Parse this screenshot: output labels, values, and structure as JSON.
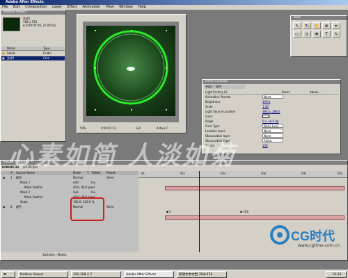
{
  "app": {
    "title": "Adobe After Effects"
  },
  "menu": [
    "File",
    "Edit",
    "Composition",
    "Layer",
    "Effect",
    "Animation",
    "View",
    "Window",
    "Help"
  ],
  "project": {
    "title": "Untitled Project",
    "comp_name": "合成1",
    "info1": "768 x 576",
    "info2": "Δ 0:00:05:00, 25.00 fps",
    "headers": [
      "Name",
      "Type"
    ],
    "rows": [
      {
        "name": "Solids",
        "type": "Folder"
      },
      {
        "name": "合成1",
        "type": "Com"
      }
    ]
  },
  "comp_window": {
    "zoom": "50%",
    "timecode": "0:00:01:12",
    "resolution": "Full",
    "camera": "Active C"
  },
  "tools": {
    "title": "Tools"
  },
  "effects": {
    "title": "Effect Controls",
    "layer_label": "合成1 * 颜色",
    "fx_name": "Light Factory LE",
    "fx_reset": "Reset",
    "fx_about": "About...",
    "rows": [
      {
        "label": "Animation Presets",
        "value": "None"
      },
      {
        "label": "Brightness",
        "value": "100.0"
      },
      {
        "label": "Scale",
        "value": "1.00"
      },
      {
        "label": "Light Source Location",
        "value": "384.0, 288.0"
      },
      {
        "label": "Color",
        "value": ""
      },
      {
        "label": "Angle",
        "value": "0 x +0.0 dp"
      },
      {
        "label": "Flare Type",
        "value": "Basic Lens"
      },
      {
        "label": "Location layer",
        "value": "None"
      },
      {
        "label": "Obscuration layer",
        "value": "None"
      },
      {
        "label": "Obscuration Type",
        "value": "Alpha"
      },
      {
        "label": "Source size",
        "value": "100"
      }
    ]
  },
  "watermark": "心素如简 人淡如菊",
  "timeline": {
    "tab": "合成1 • Timeline",
    "timecode": "0:00:01:12",
    "fps": "(25.00 fps)",
    "headers": [
      "#",
      "Source Name",
      "Mode",
      "T",
      "TrkMat",
      "Parent"
    ],
    "rows": [
      {
        "num": "1",
        "name": "颜色",
        "mode": "Normal",
        "trk": "",
        "parent": "None"
      },
      {
        "num": "",
        "name": "Mask 1",
        "mode": "Add",
        "trk": "Inv",
        "parent": ""
      },
      {
        "num": "",
        "name": "Mask Feather",
        "mode": "40.0, 40.0 pixel",
        "trk": "",
        "parent": ""
      },
      {
        "num": "",
        "name": "Mask 2",
        "mode": "Sub",
        "trk": "Inv",
        "parent": ""
      },
      {
        "num": "",
        "name": "Mask Feather",
        "mode": "40.0, 40.0 pixel",
        "trk": "",
        "parent": ""
      },
      {
        "num": "",
        "name": "Scale",
        "mode": "100.0, 100.0 %",
        "trk": "",
        "parent": ""
      },
      {
        "num": "2",
        "name": "颜色",
        "mode": "Normal",
        "trk": "",
        "parent": "None"
      }
    ],
    "ruler": [
      "0s",
      "01s",
      "02s",
      "03s",
      "04s",
      "05s"
    ],
    "footer": "Switches / Modes",
    "key_values": [
      "0",
      "100"
    ]
  },
  "logo": {
    "text": "CG时代",
    "url": "www.cgtime.com.cn"
  },
  "taskbar": [
    {
      "label": "Kadhen Viewer"
    },
    {
      "label": "192.168.2.7"
    },
    {
      "label": "Adobe After Effects"
    },
    {
      "label": "新建文本文档 768x576"
    }
  ],
  "clock": "10:26"
}
